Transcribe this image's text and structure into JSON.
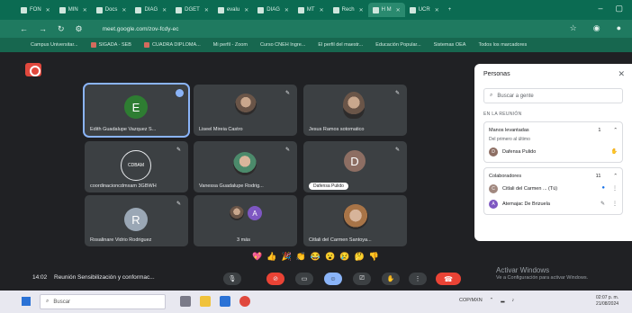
{
  "browser": {
    "tabs": [
      {
        "label": "FON"
      },
      {
        "label": "MIN"
      },
      {
        "label": "Docs"
      },
      {
        "label": "DIAG"
      },
      {
        "label": "DGET"
      },
      {
        "label": "evalu"
      },
      {
        "label": "DIAG"
      },
      {
        "label": "MT"
      },
      {
        "label": "Rech"
      },
      {
        "label": "H M"
      },
      {
        "label": "UCR"
      }
    ],
    "url": "meet.google.com/zov-fcdy-ec",
    "bookmarks": [
      "Campus Universitar...",
      "SIGADA - SEB",
      "CUADRA DIPLOMA...",
      "Mi perfil - Zoom",
      "Curso CNEH Ingre...",
      "El perfil del maestr...",
      "Educación Popular...",
      "Sistemas OEA",
      "Todos los marcadores"
    ]
  },
  "meet": {
    "tiles": [
      {
        "name": "Edith Guadalupe Vazquez S...",
        "initial": "E",
        "avatar_color": "#2e7d32"
      },
      {
        "name": "Liseel Mireia Castro",
        "initial": "",
        "avatar_color": ""
      },
      {
        "name": "Jesus Ramos sotomatico",
        "initial": "",
        "avatar_color": ""
      },
      {
        "name": "coordinacioncdmxam 3GBWH",
        "initial": "CDBAM",
        "avatar_color": ""
      },
      {
        "name": "Vanessa Guadalupe Rodrig...",
        "initial": "",
        "avatar_color": ""
      },
      {
        "name": "Dafensa Pulido",
        "initial": "D",
        "avatar_color": "#8d6e63"
      },
      {
        "name": "Rosalinare Vidrio Rodriguez",
        "initial": "R",
        "avatar_color": "#9aa7b5"
      },
      {
        "name": "3 más",
        "initial": "A",
        "avatar_color": "#7e57c2"
      },
      {
        "name": "Citlali del Carmen Santoya...",
        "initial": "",
        "avatar_color": ""
      }
    ],
    "reactions": [
      "💖",
      "👍",
      "🎉",
      "👏",
      "😂",
      "😮",
      "😢",
      "🤔",
      "👎"
    ]
  },
  "panel": {
    "title": "Personas",
    "search_placeholder": "Buscar a gente",
    "section_label": "EN LA REUNIÓN",
    "raised": {
      "label": "Manos levantadas",
      "count": "1",
      "sub": "Del primero al último",
      "person": "Dafensa Pulido"
    },
    "collab": {
      "label": "Colaboradores",
      "count": "11"
    },
    "people": [
      {
        "name": "Citlali del Carmen ... (Tú)",
        "initial": "C",
        "color": "#a1887f"
      },
      {
        "name": "Atemajac De Brizuela",
        "initial": "A",
        "color": "#7e57c2"
      }
    ]
  },
  "bottom": {
    "time": "14:02",
    "meeting_title": "Reunión Sensibilización y conformac...",
    "watermark_title": "Activar Windows",
    "watermark_sub": "Ve a Configuración para activar Windows."
  },
  "taskbar": {
    "search_placeholder": "Buscar",
    "tray_text": "COP/MXN",
    "clock_time": "02:07 p. m.",
    "clock_date": "21/08/2024"
  }
}
